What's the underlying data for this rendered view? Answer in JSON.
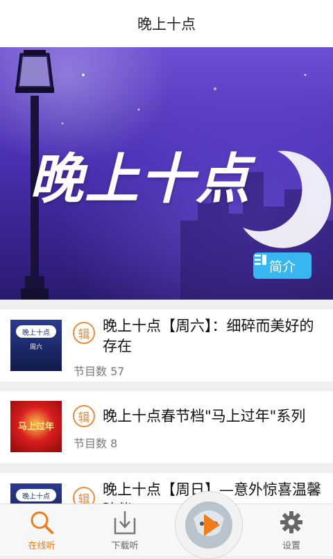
{
  "header": {
    "title": "晚上十点"
  },
  "hero": {
    "title_art": "晚上十点",
    "intro_label": "简介"
  },
  "albums": [
    {
      "badge": "辑",
      "title": "晚上十点【周六】：细碎而美好的存在",
      "count": "节目数 57",
      "thumb_text": "晚上十点",
      "thumb_sub": "周六"
    },
    {
      "badge": "辑",
      "title": "晚上十点春节档\"马上过年\"系列",
      "count": "节目数 8",
      "thumb_text": "马上过年"
    },
    {
      "badge": "辑",
      "title": "晚上十点【周日】—意外惊喜温馨陪伴",
      "thumb_text": "晚上十点"
    }
  ],
  "tabbar": {
    "online": "在线听",
    "download": "下载听",
    "settings": "设置"
  },
  "colors": {
    "accent": "#f07c1e",
    "badge": "#f08a3a",
    "intro_button": "#38b6f0"
  }
}
